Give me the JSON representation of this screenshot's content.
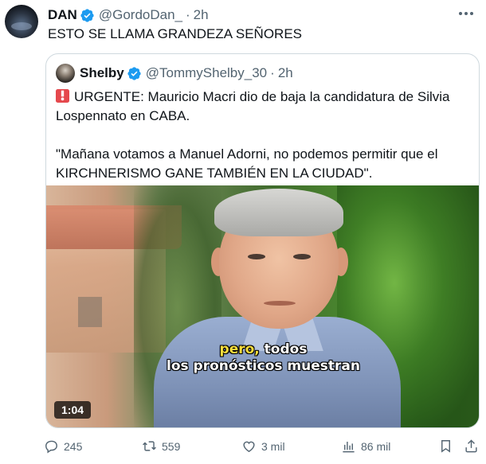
{
  "tweet": {
    "author_name": "DAN",
    "author_handle": "@GordoDan_",
    "separator": "·",
    "time": "2h",
    "text": "ESTO SE LLAMA GRANDEZA SEÑORES"
  },
  "quoted": {
    "author_name": "Shelby",
    "author_handle": "@TommyShelby_30",
    "separator": "·",
    "time": "2h",
    "lines": [
      "URGENTE: Mauricio Macri dio de baja la candidatura de Silvia",
      "Lospennato en CABA.",
      "\"Mañana votamos a Manuel Adorni, no podemos permitir que el",
      "KIRCHNERISMO GANE TAMBIÉN EN LA CIUDAD\"."
    ],
    "video": {
      "caption_line1_highlight": "pero,",
      "caption_line1_rest": " todos",
      "caption_line2": "los pronósticos muestran",
      "duration": "1:04"
    }
  },
  "actions": {
    "replies": "245",
    "reposts": "559",
    "likes": "3 mil",
    "views": "86 mil"
  },
  "colors": {
    "text": "#0f1419",
    "muted": "#536471",
    "verified": "#1d9bf0",
    "border": "#cfd9de",
    "caption_highlight": "#f7dd3c"
  },
  "icons": [
    "verified-badge-icon",
    "more-icon",
    "siren-icon",
    "reply-icon",
    "repost-icon",
    "like-icon",
    "views-icon",
    "bookmark-icon",
    "share-icon"
  ]
}
